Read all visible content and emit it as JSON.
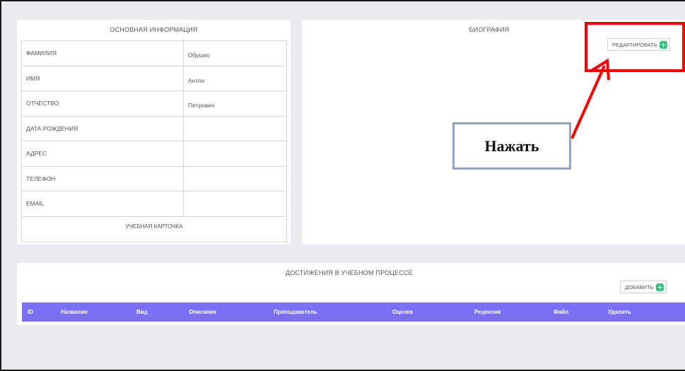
{
  "main_info": {
    "title": "ОСНОВНАЯ ИНФОРМАЦИЯ",
    "rows": [
      {
        "label": "ФАМИЛИЯ",
        "value": "Обушко"
      },
      {
        "label": "ИМЯ",
        "value": "Антон"
      },
      {
        "label": "ОТЧЕСТВО",
        "value": "Петрович"
      },
      {
        "label": "ДАТА РОЖДЕНИЯ",
        "value": ""
      },
      {
        "label": "АДРЕС",
        "value": ""
      },
      {
        "label": "ТЕЛЕФОН",
        "value": ""
      },
      {
        "label": "EMAIL",
        "value": ""
      }
    ],
    "card_link": "УЧЕБНАЯ КАРТОЧКА"
  },
  "biography": {
    "title": "БИОГРАФИЯ",
    "edit_label": "РЕДАКТИРОВАТЬ"
  },
  "annotation": {
    "callout_text": "Нажать",
    "highlight_color": "#ff0000",
    "callout_border_color": "#8ea3c8"
  },
  "achievements": {
    "title": "ДОСТИЖЕНИЯ В УЧЕБНОМ ПРОЦЕССЕ",
    "add_label": "ДОБАВИТЬ",
    "header_color": "#7b6ff5",
    "columns": [
      "ID",
      "Название",
      "Вид",
      "Описание",
      "Преподаватель",
      "Оценка",
      "Рецензии",
      "Файл",
      "Удалить"
    ]
  },
  "icons": {
    "add": "plus-square-icon",
    "edit": "plus-square-icon"
  },
  "colors": {
    "background": "#e9ebee",
    "card": "#ffffff",
    "accent_green": "#2fc27a"
  }
}
